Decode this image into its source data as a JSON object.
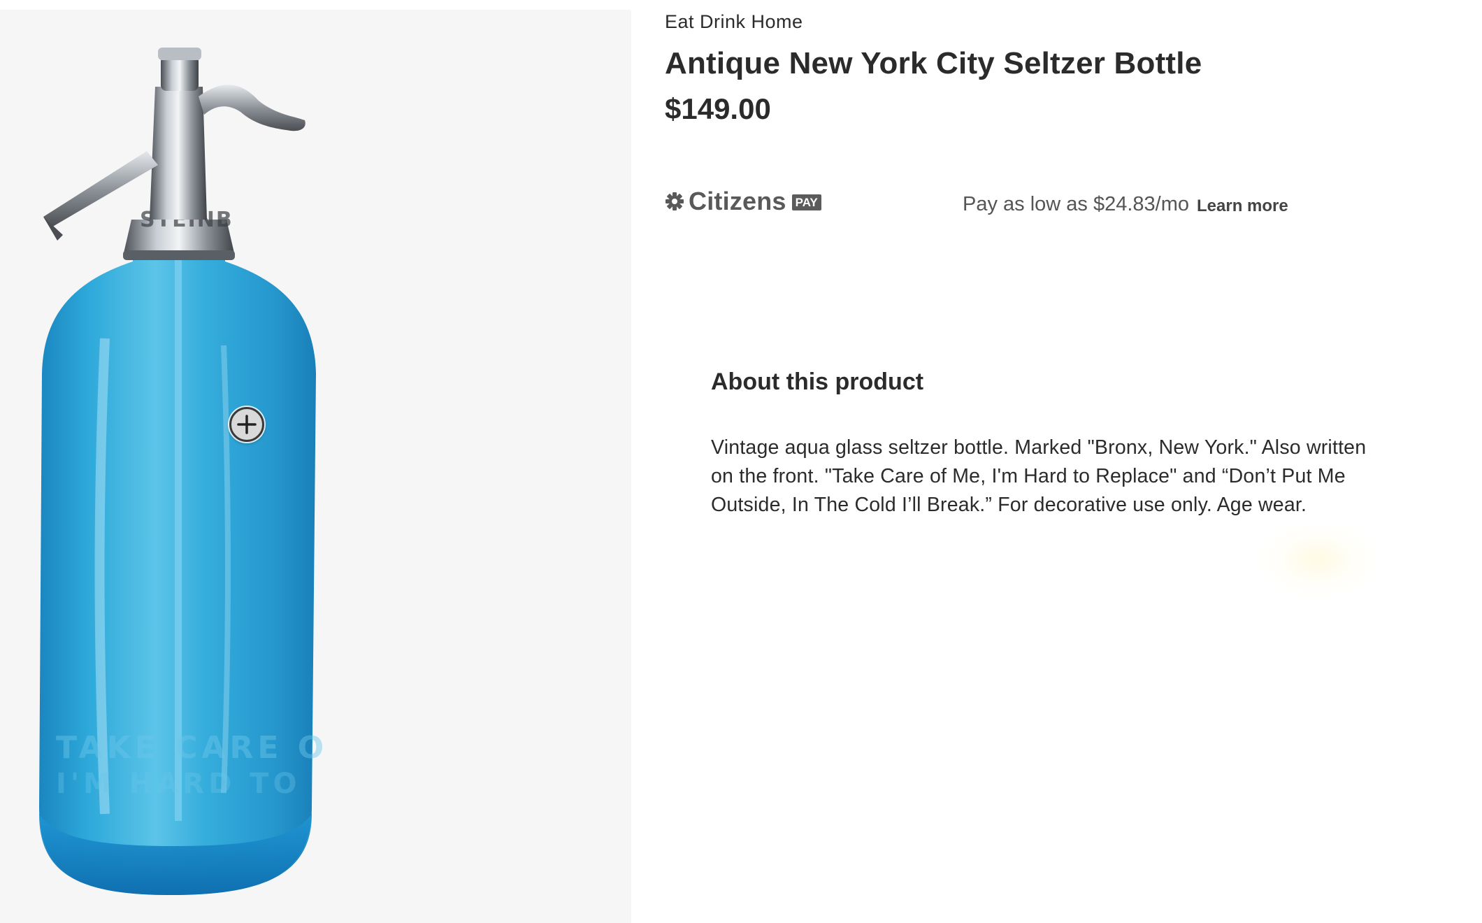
{
  "product": {
    "vendor": "Eat Drink Home",
    "title": "Antique New York City Seltzer Bottle",
    "price": "$149.00",
    "image": {
      "subject": "blue glass seltzer bottle with metal siphon top",
      "zoom_icon": "plus-circle-icon"
    }
  },
  "financing": {
    "provider_name": "Citizens",
    "provider_badge": "PAY",
    "provider_icon": "citizens-asterisk-icon",
    "text": "Pay as low as $24.83/mo",
    "link_label": "Learn more"
  },
  "about": {
    "heading": "About this product",
    "body": "Vintage aqua glass seltzer bottle. Marked \"Bronx, New York.\" Also written on the front. \"Take Care of Me, I'm Hard to Replace\" and “Don’t Put Me Outside, In The Cold I’ll Break.” For decorative use only. Age wear."
  },
  "colors": {
    "image_background": "#f6f6f6",
    "bottle_blue": "#2aa6d6",
    "text": "#2b2b2b",
    "muted_text": "#555555"
  }
}
